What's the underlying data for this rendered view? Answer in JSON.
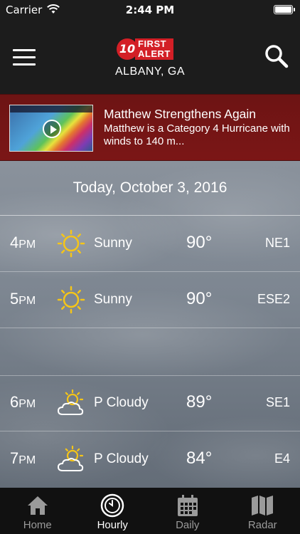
{
  "status_bar": {
    "carrier": "Carrier",
    "time": "2:44 PM"
  },
  "header": {
    "logo_number": "10",
    "logo_line1": "FIRST",
    "logo_line2": "ALERT",
    "location": "ALBANY, GA"
  },
  "news": {
    "headline": "Matthew Strengthens Again",
    "summary": "Matthew is a Category 4 Hurricane with winds to 140 m..."
  },
  "date_label": "Today, October 3, 2016",
  "hours": [
    {
      "hour": "4",
      "ampm": "PM",
      "icon": "sun-icon",
      "condition": "Sunny",
      "temp": "90°",
      "wind": "NE1"
    },
    {
      "hour": "5",
      "ampm": "PM",
      "icon": "sun-icon",
      "condition": "Sunny",
      "temp": "90°",
      "wind": "ESE2"
    },
    {
      "hour": "6",
      "ampm": "PM",
      "icon": "partly-cloudy-icon",
      "condition": "P Cloudy",
      "temp": "89°",
      "wind": "SE1"
    },
    {
      "hour": "7",
      "ampm": "PM",
      "icon": "partly-cloudy-icon",
      "condition": "P Cloudy",
      "temp": "84°",
      "wind": "E4"
    }
  ],
  "tabs": [
    {
      "label": "Home",
      "icon": "home-icon",
      "active": false
    },
    {
      "label": "Hourly",
      "icon": "clock-icon",
      "active": true
    },
    {
      "label": "Daily",
      "icon": "calendar-icon",
      "active": false
    },
    {
      "label": "Radar",
      "icon": "map-icon",
      "active": false
    }
  ],
  "colors": {
    "accent_red": "#d31f26",
    "news_bg": "#7b1616",
    "sun_yellow": "#f5c518"
  }
}
